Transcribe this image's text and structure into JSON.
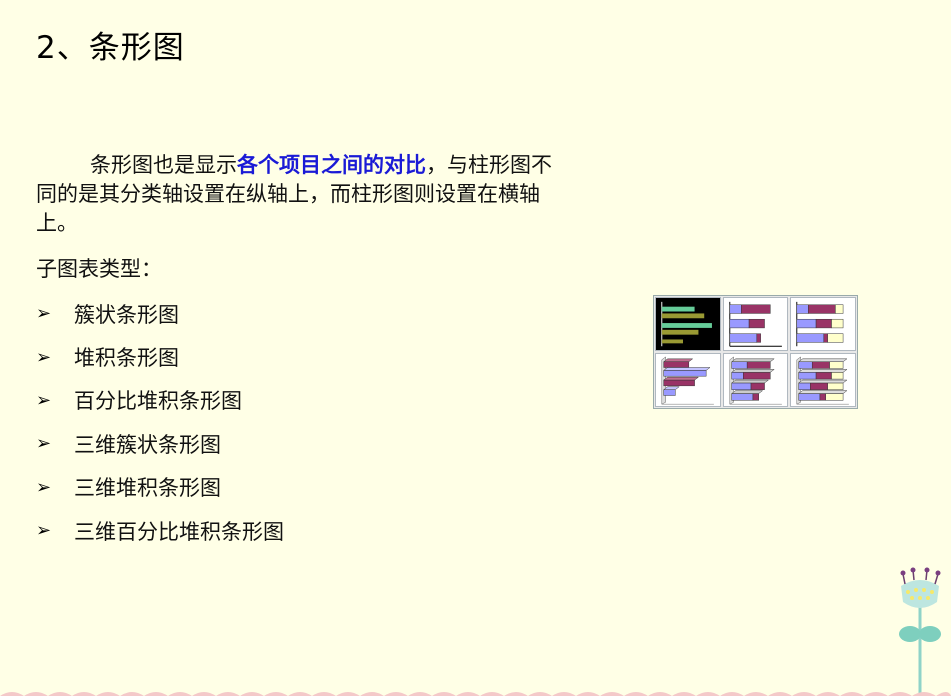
{
  "title": "2、条形图",
  "intro": {
    "part1": "条形图也是显示",
    "highlight": "各个项目之间的对比",
    "part2": "，与柱形图不同的是其分类轴设置在纵轴上，而柱形图则设置在横轴上。"
  },
  "subtitle": "子图表类型：",
  "bullet_icon": "arrow-bullet-icon",
  "bullets": [
    "簇状条形图",
    "堆积条形图",
    "百分比堆积条形图",
    "三维簇状条形图",
    "三维堆积条形图",
    "三维百分比堆积条形图"
  ],
  "chart_subtypes_icons": [
    "clustered-bar-icon",
    "stacked-bar-icon",
    "percent-stacked-bar-icon",
    "clustered-bar-3d-icon",
    "stacked-bar-3d-icon",
    "percent-stacked-bar-3d-icon"
  ],
  "colors": {
    "background": "#FFFFE6",
    "highlight_text": "#1a1ad6",
    "bar_blue": "#9999FF",
    "bar_maroon": "#993366",
    "bar_cream": "#FFFFCC",
    "bar_teal": "#66CC99",
    "bar_olive": "#999933"
  }
}
